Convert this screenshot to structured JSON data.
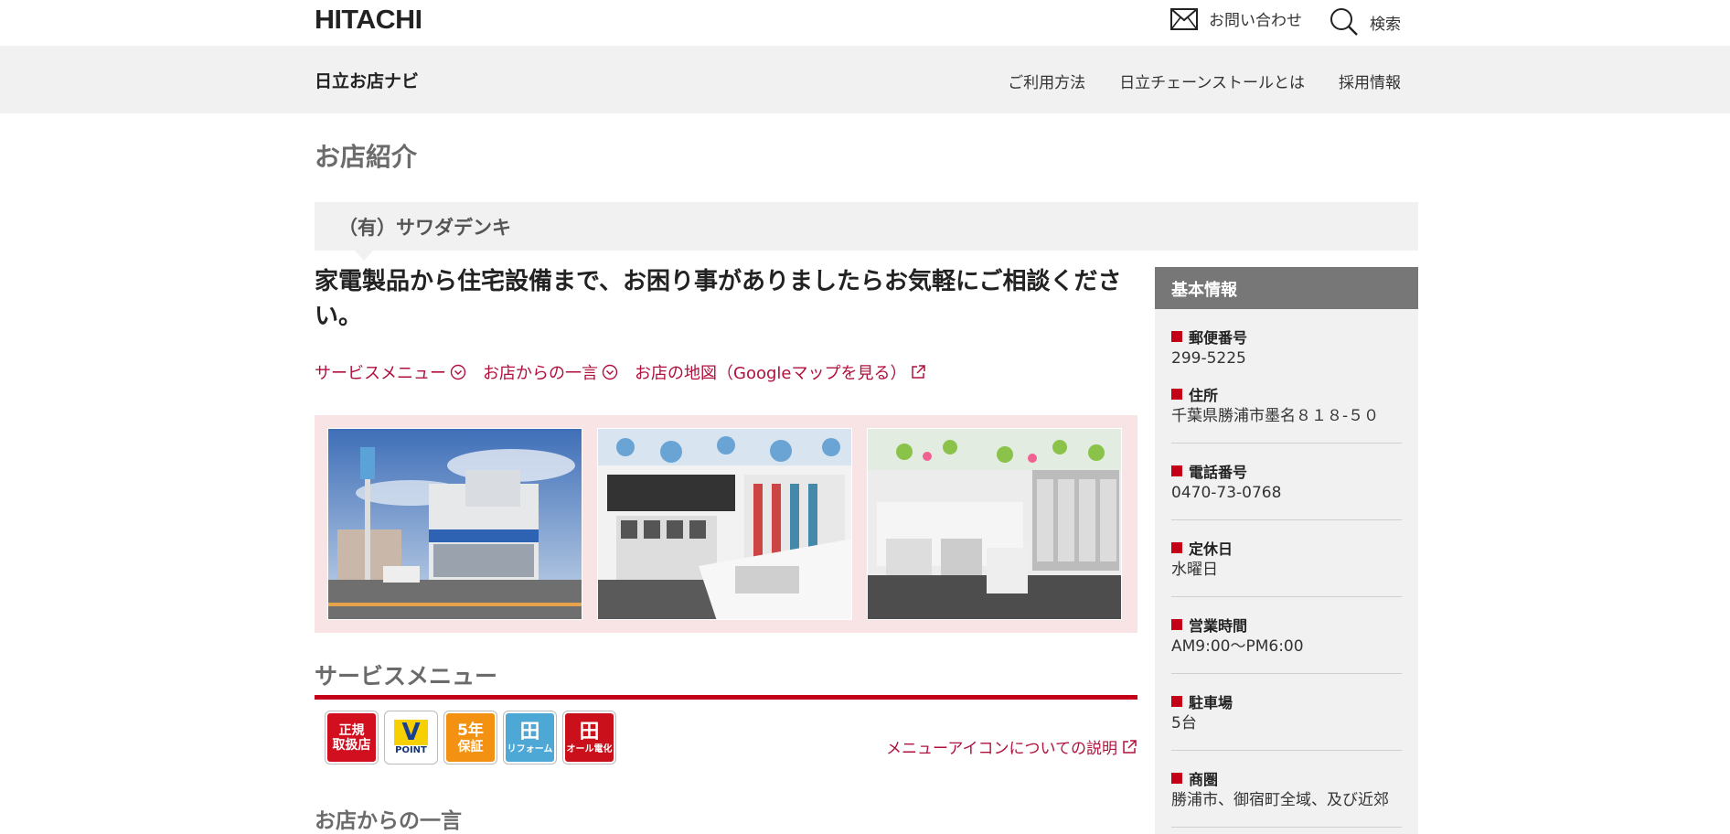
{
  "header": {
    "logo": "HITACHI",
    "contact_label": "お問い合わせ",
    "search_label": "検索"
  },
  "nav": {
    "site_name": "日立お店ナビ",
    "links": [
      "ご利用方法",
      "日立チェーンストールとは",
      "採用情報"
    ]
  },
  "page": {
    "title": "お店紹介",
    "shop_name": "（有）サワダデンキ",
    "headline": "家電製品から住宅設備まで、お困り事がありましたらお気軽にご相談ください。",
    "anchors": [
      "サービスメニュー",
      "お店からの一言",
      "お店の地図（Googleマップを見る）"
    ]
  },
  "service": {
    "title": "サービスメニュー",
    "icons": [
      {
        "line1": "正規",
        "line2": "取扱店"
      },
      {
        "line1": "V",
        "line2": "POINT"
      },
      {
        "line1": "5年",
        "line2": "保証"
      },
      {
        "line1": "田",
        "line2": "リフォーム"
      },
      {
        "line1": "田",
        "line2": "オール電化"
      }
    ],
    "explain_link": "メニューアイコンについての説明"
  },
  "message": {
    "title": "お店からの一言"
  },
  "info": {
    "title": "基本情報",
    "items": [
      {
        "label": "郵便番号",
        "value": "299-5225"
      },
      {
        "label": "住所",
        "value": "千葉県勝浦市墨名８１８-５０"
      },
      {
        "label": "電話番号",
        "value": "0470-73-0768"
      },
      {
        "label": "定休日",
        "value": "水曜日"
      },
      {
        "label": "営業時間",
        "value": "AM9:00～PM6:00"
      },
      {
        "label": "駐車場",
        "value": "5台"
      },
      {
        "label": "商圏",
        "value": "勝浦市、御宿町全域、及び近郊"
      }
    ]
  }
}
